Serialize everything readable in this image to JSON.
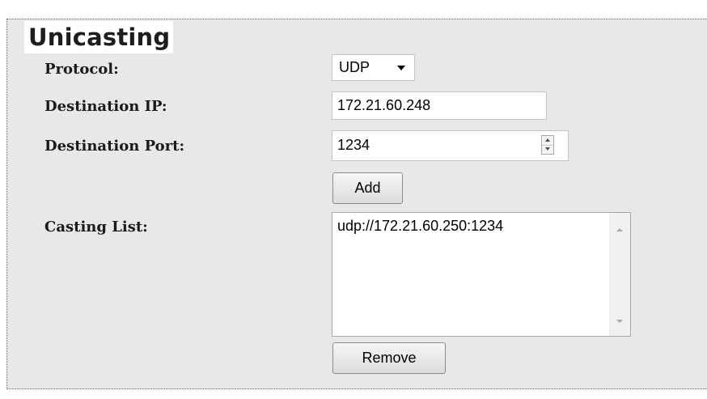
{
  "section": {
    "title": "Unicasting"
  },
  "form": {
    "protocol_label": "Protocol:",
    "protocol_value": "UDP",
    "destination_ip_label": "Destination IP:",
    "destination_ip_value": "172.21.60.248",
    "destination_port_label": "Destination Port:",
    "destination_port_value": "1234",
    "add_label": "Add",
    "casting_list_label": "Casting List:",
    "casting_list_items": [
      "udp://172.21.60.250:1234"
    ],
    "remove_label": "Remove"
  },
  "icons": {
    "protocol_dropdown": "chevron-down-icon",
    "port_spinner_up": "spin-up-icon",
    "port_spinner_down": "spin-down-icon",
    "list_scroll_up": "scroll-up-icon",
    "list_scroll_down": "scroll-down-icon"
  },
  "colors": {
    "panel_background": "#e8e8e8",
    "border": "#6a6a6a",
    "label_text": "#1a1a1a"
  }
}
